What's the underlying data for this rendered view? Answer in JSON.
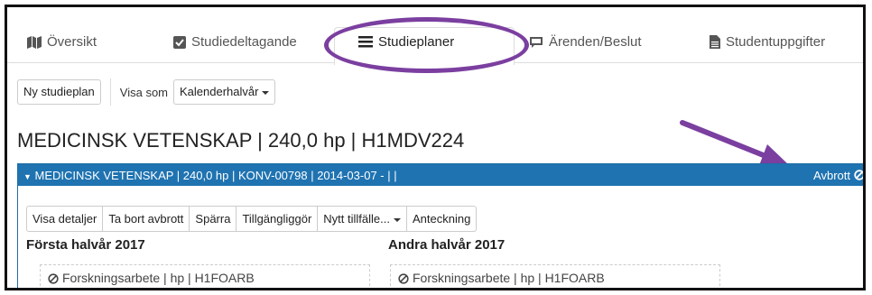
{
  "tabs": [
    {
      "label": "Översikt",
      "icon": "map-icon"
    },
    {
      "label": "Studiedeltagande",
      "icon": "checkbox-icon"
    },
    {
      "label": "Studieplaner",
      "icon": "list-icon",
      "active": true
    },
    {
      "label": "Ärenden/Beslut",
      "icon": "comment-icon"
    },
    {
      "label": "Studentuppgifter",
      "icon": "file-icon"
    }
  ],
  "toolbar": {
    "new_plan": "Ny studieplan",
    "view_as_label": "Visa som",
    "view_as_value": "Kalenderhalvår"
  },
  "program_title": "MEDICINSK VETENSKAP | 240,0 hp | H1MDV224",
  "panel": {
    "header": "MEDICINSK VETENSKAP | 240,0 hp | KONV-00798 | 2014-03-07 - | |",
    "status": "Avbrott"
  },
  "actions": [
    "Visa detaljer",
    "Ta bort avbrott",
    "Spärra",
    "Tillgängliggör",
    "Nytt tillfälle...",
    "Anteckning"
  ],
  "halves": [
    {
      "title": "Första halvår 2017",
      "course": "Forskningsarbete | hp | H1FOARB"
    },
    {
      "title": "Andra halvår 2017",
      "course": "Forskningsarbete | hp | H1FOARB"
    }
  ],
  "colors": {
    "accent": "#1f73b1",
    "annotation": "#7b3fa0"
  }
}
